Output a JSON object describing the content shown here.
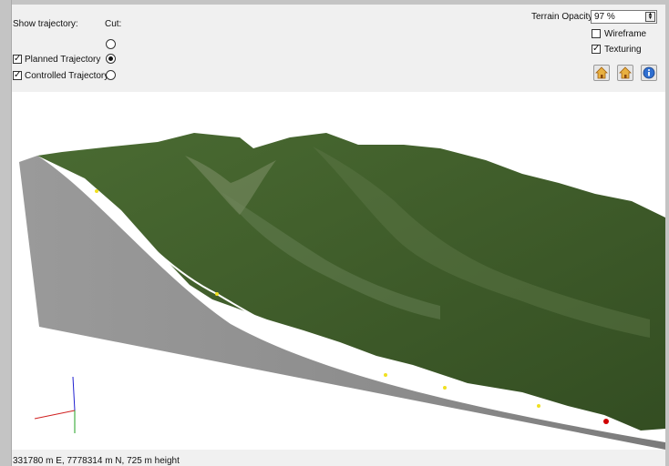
{
  "controls": {
    "show_trajectory_label": "Show trajectory:",
    "cut_label": "Cut:",
    "planned_trajectory": {
      "label": "Planned Trajectory",
      "checked": true,
      "cut_selected": true
    },
    "controlled_trajectory": {
      "label": "Controlled Trajectory",
      "checked": true,
      "cut_selected": false
    },
    "top_cut_selected": false
  },
  "terrain": {
    "opacity_label": "Terrain Opacity:",
    "opacity_value": "97 %",
    "wireframe": {
      "label": "Wireframe",
      "checked": false
    },
    "texturing": {
      "label": "Texturing",
      "checked": true
    }
  },
  "toolbar": {
    "buttons": [
      {
        "name": "home-view-button",
        "icon": "home-icon"
      },
      {
        "name": "home-alt-view-button",
        "icon": "home-icon"
      },
      {
        "name": "info-button",
        "icon": "info-icon"
      }
    ]
  },
  "scene": {
    "terrain_color": "#3f5c2a",
    "cut_color": "#8e8e8e",
    "trajectory_color": "#ffffff",
    "waypoint_color": "#f0e020",
    "target_color": "#d00000",
    "axis_colors": {
      "x": "#d02020",
      "y": "#20a020",
      "z": "#2020d0"
    }
  },
  "status": {
    "coordinates": "331780 m E, 7778314 m N, 725 m height"
  }
}
